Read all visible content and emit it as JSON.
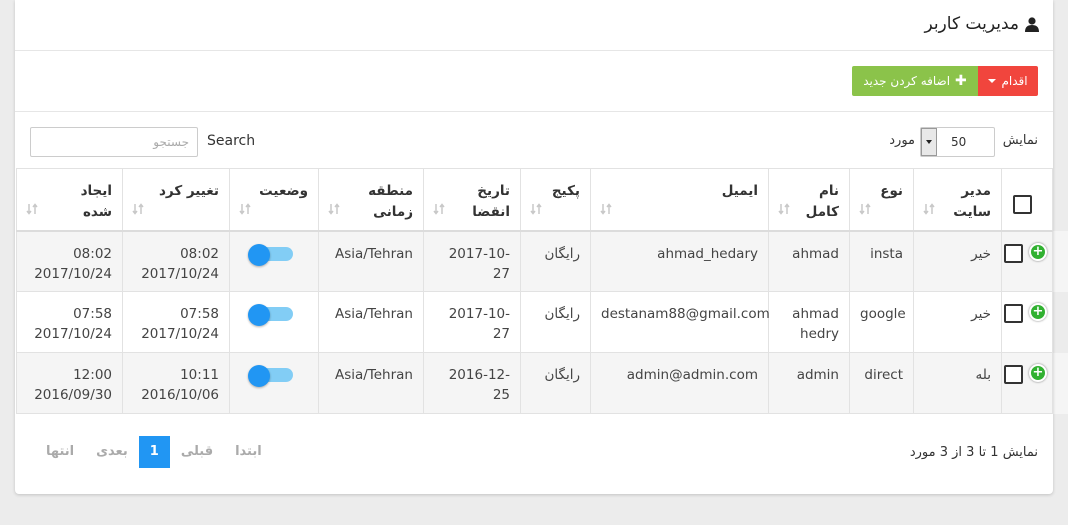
{
  "header": {
    "title": "مدیریت کاربر"
  },
  "toolbar": {
    "actions_label": "اقدام",
    "add_label": "اضافه کردن جدید"
  },
  "controls": {
    "show_label": "نمایش",
    "page_length": "50",
    "items_label": "مورد",
    "search_label": "Search",
    "search_placeholder": "جستجو"
  },
  "table": {
    "columns": [
      "مدیر\nسایت",
      "نوع",
      "نام\nکامل",
      "ایمیل",
      "پکیج",
      "تاریخ\nانقضا",
      "منطقه\nزمانی",
      "وضعیت",
      "تغییر کرد",
      "ایجاد\nشده"
    ],
    "rows": [
      {
        "admin": "خیر",
        "type": "insta",
        "fullname": "ahmad",
        "email": "ahmad_hedary",
        "package": "رایگان",
        "expiry": "2017-10-27",
        "timezone": "Asia/Tehran",
        "status_on": true,
        "modified": "08:02\n2017/10/24",
        "created": "08:02\n2017/10/24"
      },
      {
        "admin": "خیر",
        "type": "google",
        "fullname": "ahmad\nhedry",
        "email": "destanam88@gmail.com",
        "package": "رایگان",
        "expiry": "2017-10-27",
        "timezone": "Asia/Tehran",
        "status_on": true,
        "modified": "07:58\n2017/10/24",
        "created": "07:58\n2017/10/24"
      },
      {
        "admin": "بله",
        "type": "direct",
        "fullname": "admin",
        "email": "admin@admin.com",
        "package": "رایگان",
        "expiry": "2016-12-25",
        "timezone": "Asia/Tehran",
        "status_on": true,
        "modified": "10:11\n2016/10/06",
        "created": "12:00\n2016/09/30"
      }
    ]
  },
  "footer": {
    "info": "نمایش 1 تا 3 از 3 مورد",
    "pager": {
      "first": "ابتدا",
      "prev": "قبلی",
      "current": "1",
      "next": "بعدی",
      "last": "انتها"
    }
  },
  "colors": {
    "danger": "#f1453d",
    "success": "#8bc34a",
    "primary": "#2196f3",
    "expand": "#31b131"
  }
}
